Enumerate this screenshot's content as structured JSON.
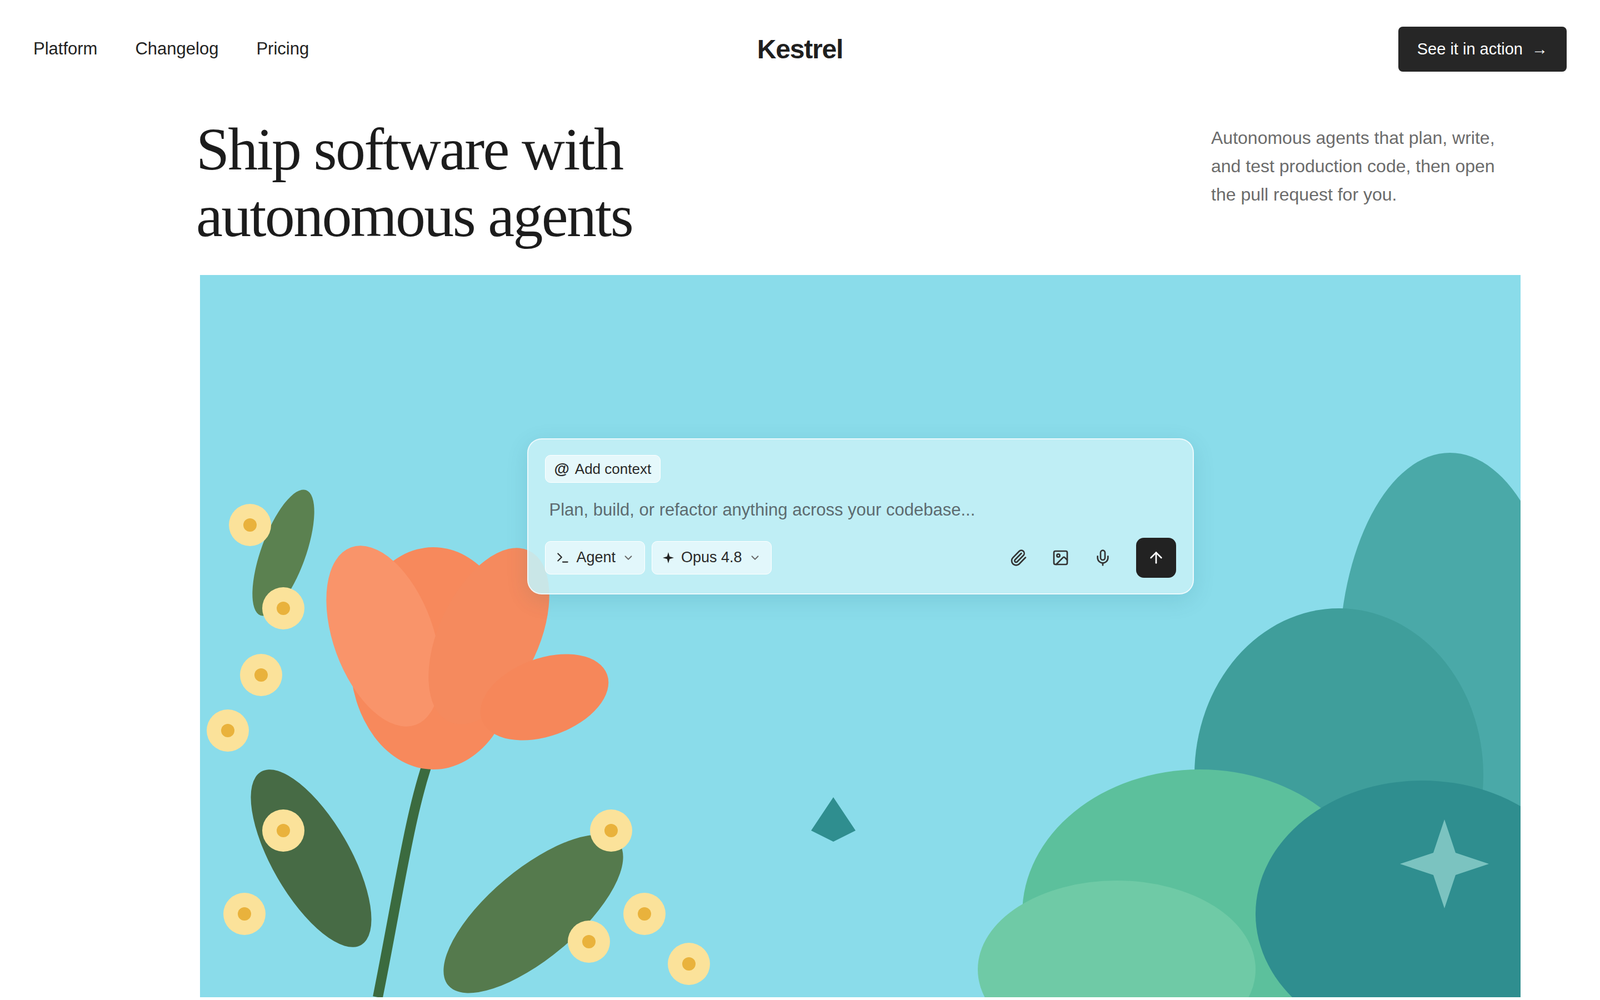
{
  "nav": {
    "links": [
      {
        "label": "Platform"
      },
      {
        "label": "Changelog"
      },
      {
        "label": "Pricing"
      }
    ],
    "brand": "Kestrel",
    "cta": {
      "label": "See it in action",
      "arrow": "→"
    }
  },
  "hero": {
    "title_lines": [
      "Ship software with",
      "autonomous agents"
    ],
    "subtitle": "Autonomous agents that plan, write, and test production code, then open the pull request for you."
  },
  "prompt": {
    "context_chip": {
      "symbol": "@",
      "label": "Add context"
    },
    "placeholder": "Plan, build, or refactor anything across your codebase...",
    "mode": {
      "label": "Agent"
    },
    "model": {
      "label": "Opus 4.8"
    }
  }
}
